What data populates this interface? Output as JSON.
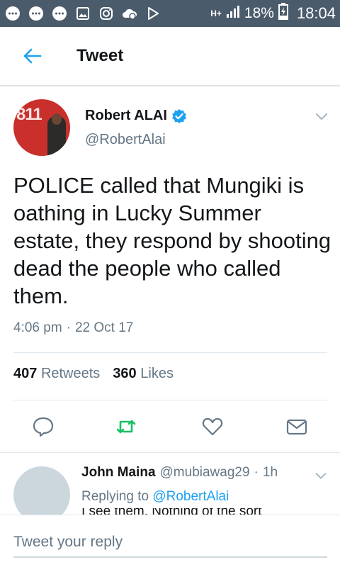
{
  "status_bar": {
    "network": "H+",
    "battery": "18%",
    "time": "18:04",
    "icons": [
      "chat-bubble-icon",
      "chat-bubble-icon",
      "chat-bubble-icon",
      "image-icon",
      "instagram-icon",
      "cloud-icon",
      "play-store-icon"
    ]
  },
  "app_bar": {
    "title": "Tweet",
    "back_icon": "arrow-left-icon"
  },
  "tweet": {
    "author_name": "Robert ALAI",
    "handle": "@RobertAlai",
    "verified": true,
    "avatar_sign": "811",
    "text": "POLICE called that Mungiki is oathing in Lucky Summer estate, they respond by shooting dead the people who called them.",
    "time": "4:06 pm",
    "separator": "·",
    "date": "22 Oct 17",
    "retweets_count": "407",
    "retweets_label": "Retweets",
    "likes_count": "360",
    "likes_label": "Likes"
  },
  "actions": [
    "reply-icon",
    "retweet-icon",
    "like-icon",
    "share-icon"
  ],
  "reply": {
    "name": "John Maina",
    "handle": "@mubiawag29",
    "separator": "·",
    "time": "1h",
    "replying_prefix": "Replying to",
    "replying_to": "@RobertAlai",
    "cut_text": "I see them. Nothing of the sort"
  },
  "composer": {
    "placeholder": "Tweet your reply"
  },
  "colors": {
    "accent": "#1da1f2",
    "retweet": "#17bf63",
    "statusbar": "#4a5b6c",
    "muted": "#657786"
  }
}
